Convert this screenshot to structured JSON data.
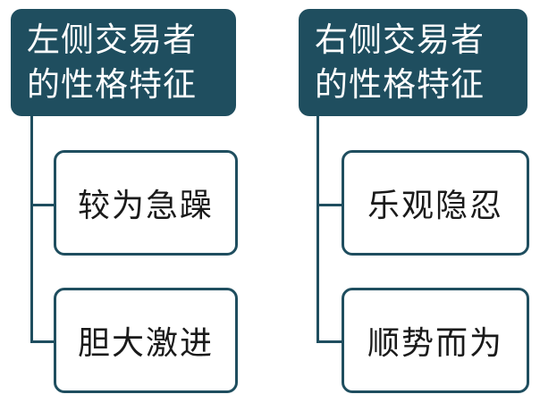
{
  "left": {
    "title": "左侧交易者\n的性格特征",
    "items": [
      "较为急躁",
      "胆大激进"
    ]
  },
  "right": {
    "title": "右侧交易者\n的性格特征",
    "items": [
      "乐观隐忍",
      "顺势而为"
    ]
  },
  "colors": {
    "header_bg": "#1f4e5f",
    "connector": "#1f4e5f",
    "box_border": "#1f4e5f"
  }
}
